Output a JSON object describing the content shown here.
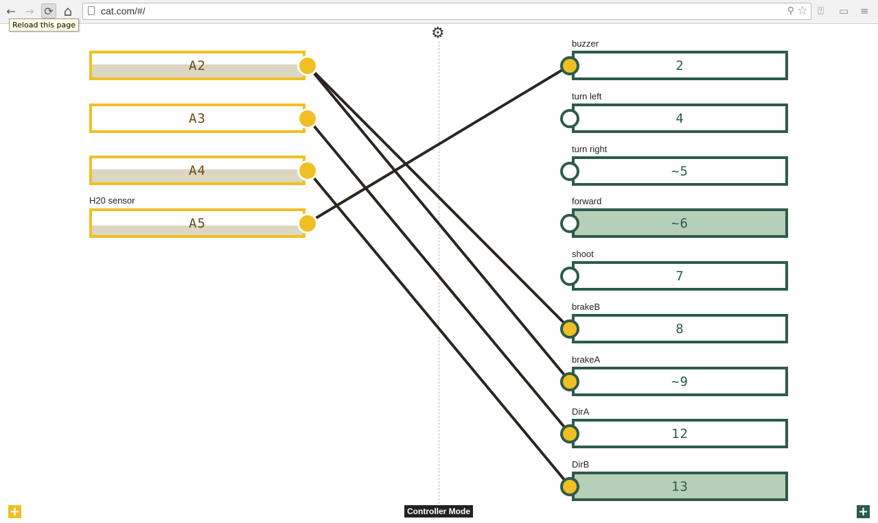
{
  "browser": {
    "url": "cat.com/#/",
    "tooltip": "Reload this page",
    "back_icon": "←",
    "forward_icon": "→",
    "reload_icon": "⟳",
    "home_icon": "⌂"
  },
  "inputs": [
    {
      "pin": "A2",
      "name": "",
      "level": 0.55
    },
    {
      "pin": "A3",
      "name": "",
      "level": 0
    },
    {
      "pin": "A4",
      "name": "",
      "level": 0.55
    },
    {
      "pin": "A5",
      "name": "H20 sensor",
      "level": 0.4
    }
  ],
  "outputs": [
    {
      "pin": "2",
      "name": "buzzer",
      "connected": true,
      "level": 0
    },
    {
      "pin": "4",
      "name": "turn left",
      "connected": false,
      "level": 0
    },
    {
      "pin": "~5",
      "name": "turn right",
      "connected": false,
      "level": 0
    },
    {
      "pin": "~6",
      "name": "forward",
      "connected": false,
      "level": 1
    },
    {
      "pin": "7",
      "name": "shoot",
      "connected": false,
      "level": 0
    },
    {
      "pin": "8",
      "name": "brakeB",
      "connected": true,
      "level": 0
    },
    {
      "pin": "~9",
      "name": "brakeA",
      "connected": true,
      "level": 0
    },
    {
      "pin": "12",
      "name": "DirA",
      "connected": true,
      "level": 0
    },
    {
      "pin": "13",
      "name": "DirB",
      "connected": true,
      "level": 1
    }
  ],
  "connections": [
    {
      "from": "A2",
      "to": "8"
    },
    {
      "from": "A2",
      "to": "~9"
    },
    {
      "from": "A3",
      "to": "12"
    },
    {
      "from": "A4",
      "to": "13"
    },
    {
      "from": "A5",
      "to": "2"
    }
  ],
  "footer": {
    "mode_label": "Controller Mode",
    "add_symbol": "+"
  },
  "colors": {
    "input_accent": "#f0bf23",
    "output_accent": "#2d5b49",
    "wire": "#2b2520"
  }
}
